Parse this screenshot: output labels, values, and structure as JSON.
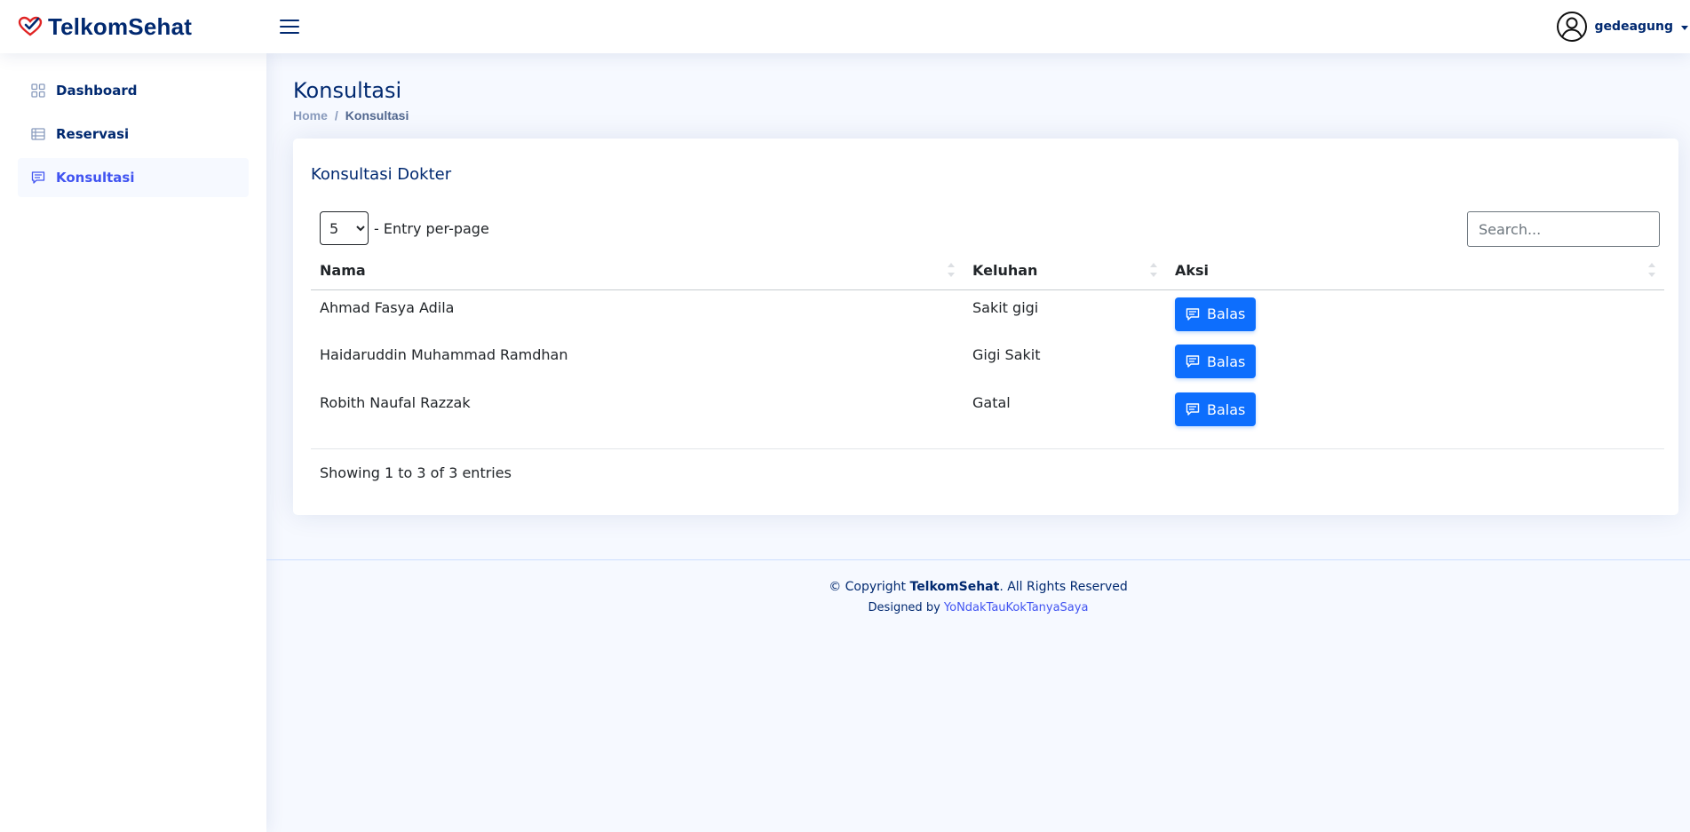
{
  "brand": {
    "name": "TelkomSehat",
    "logo_icon": "heart-check-icon",
    "accent_color": "#e02424"
  },
  "header": {
    "menu_icon": "hamburger-icon",
    "user": {
      "name": "gedeagung",
      "icon": "user-circle-icon"
    }
  },
  "sidebar": {
    "items": [
      {
        "label": "Dashboard",
        "icon": "grid-icon",
        "active": false
      },
      {
        "label": "Reservasi",
        "icon": "list-icon",
        "active": false
      },
      {
        "label": "Konsultasi",
        "icon": "chat-icon",
        "active": true
      }
    ]
  },
  "page": {
    "title": "Konsultasi",
    "breadcrumb": [
      "Home",
      "Konsultasi"
    ]
  },
  "card": {
    "title": "Konsultasi Dokter",
    "per_page": {
      "value": "5",
      "options": [
        "5"
      ],
      "label": "- Entry per-page"
    },
    "search_placeholder": "Search...",
    "columns": [
      "Nama",
      "Keluhan",
      "Aksi"
    ],
    "rows": [
      {
        "nama": "Ahmad Fasya Adila",
        "keluhan": "Sakit gigi",
        "action": "Balas"
      },
      {
        "nama": "Haidaruddin Muhammad Ramdhan",
        "keluhan": "Gigi Sakit",
        "action": "Balas"
      },
      {
        "nama": "Robith Naufal Razzak",
        "keluhan": "Gatal",
        "action": "Balas"
      }
    ],
    "showing": "Showing 1 to 3 of 3 entries"
  },
  "footer": {
    "copyright_prefix": "© Copyright ",
    "copyright_brand": "TelkomSehat",
    "copyright_suffix": ". All Rights Reserved",
    "designed_by_label": "Designed by ",
    "designer": "YoNdakTauKokTanyaSaya"
  },
  "colors": {
    "primary": "#0d6efd",
    "navy": "#012970",
    "link": "#4154f1",
    "background": "#f6f9ff"
  }
}
